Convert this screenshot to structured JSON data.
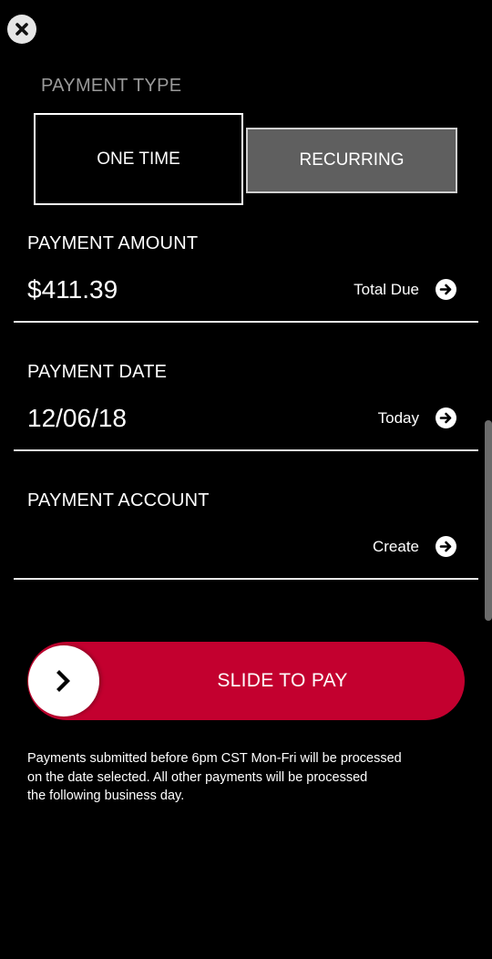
{
  "header": {
    "close_icon": "close-icon"
  },
  "payment_type": {
    "label": "PAYMENT TYPE",
    "options": [
      {
        "label": "ONE TIME",
        "selected": true
      },
      {
        "label": "RECURRING",
        "selected": false
      }
    ]
  },
  "payment_amount": {
    "title": "PAYMENT AMOUNT",
    "value": "$411.39",
    "action_label": "Total Due",
    "action_icon": "arrow-right-circle-icon"
  },
  "payment_date": {
    "title": "PAYMENT DATE",
    "value": "12/06/18",
    "action_label": "Today",
    "action_icon": "arrow-right-circle-icon"
  },
  "payment_account": {
    "title": "PAYMENT ACCOUNT",
    "value": "",
    "action_label": "Create",
    "action_icon": "arrow-right-circle-icon"
  },
  "slider": {
    "label": "SLIDE TO PAY",
    "knob_icon": "chevron-right-icon",
    "color": "#c3002f"
  },
  "disclaimer": {
    "line1": "Payments submitted before 6pm CST Mon-Fri will be processed",
    "line2": "on the date selected. All other payments will be processed",
    "line3": "the following business day."
  }
}
